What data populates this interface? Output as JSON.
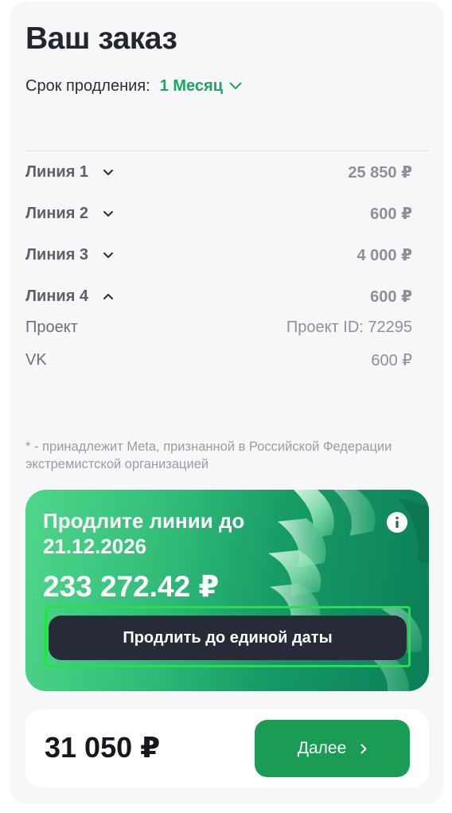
{
  "header": {
    "title": "Ваш заказ"
  },
  "period": {
    "label": "Срок продления:",
    "value": "1 Месяц",
    "icon": "chevron-down-icon"
  },
  "lines": [
    {
      "label": "Линия 1",
      "price": "25 850 ₽",
      "expanded": false
    },
    {
      "label": "Линия 2",
      "price": "600 ₽",
      "expanded": false
    },
    {
      "label": "Линия 3",
      "price": "4 000 ₽",
      "expanded": false
    },
    {
      "label": "Линия 4",
      "price": "600 ₽",
      "expanded": true,
      "details": [
        {
          "label": "Проект",
          "value": "Проект ID: 72295"
        },
        {
          "label": "VK",
          "value": "600 ₽"
        }
      ]
    }
  ],
  "footnote": "* - принадлежит Meta, признанной в Российской Федерации экстремистской организацией",
  "promo": {
    "title": "Продлите линии до 21.12.2026",
    "amount": "233 272.42 ₽",
    "button_label": "Продлить до единой даты",
    "info_icon": "info-icon"
  },
  "total": {
    "amount": "31 050 ₽",
    "next_label": "Далее",
    "next_icon": "chevron-right-icon"
  },
  "colors": {
    "accent_green": "#1ea660",
    "button_green": "#1b9c55",
    "dark_button": "#262b37",
    "panel_bg": "#f6f7f9"
  }
}
